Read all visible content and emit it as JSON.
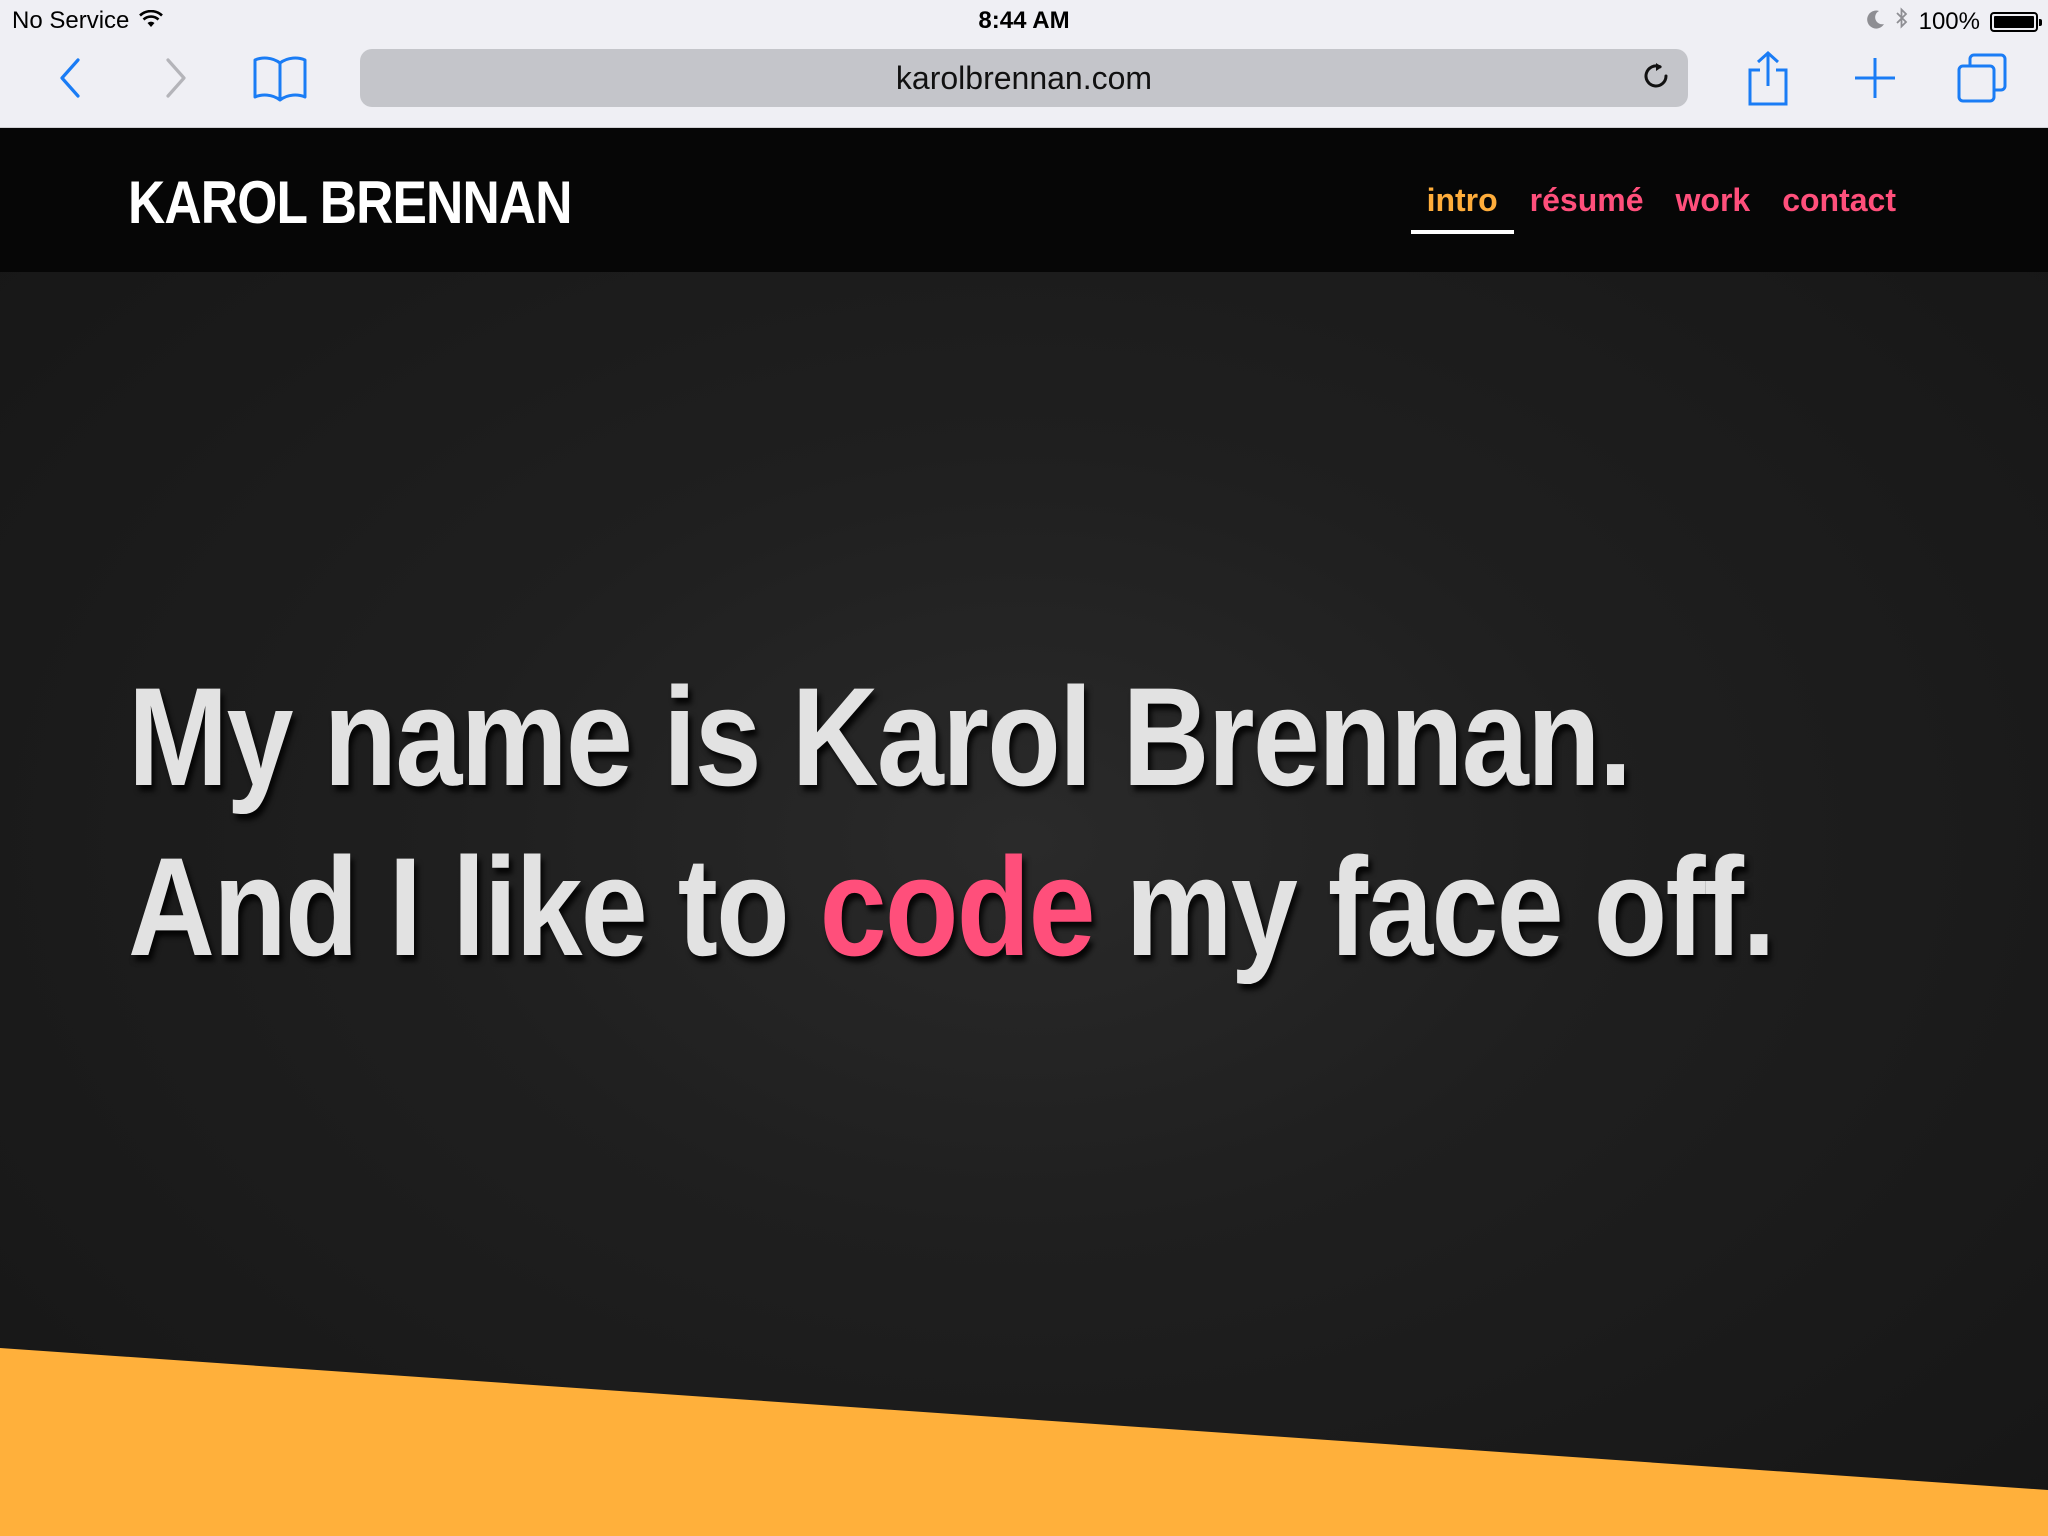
{
  "status_bar": {
    "carrier": "No Service",
    "time": "8:44 AM",
    "battery_percent": "100%",
    "battery_level": 1.0
  },
  "browser": {
    "url": "karolbrennan.com",
    "icons": {
      "back": "chevron-left-icon",
      "forward": "chevron-right-icon",
      "bookmarks": "book-icon",
      "reload": "reload-icon",
      "share": "share-icon",
      "new_tab": "plus-icon",
      "tabs": "tabs-icon"
    },
    "accent_color": "#1a7cf5"
  },
  "site": {
    "logo": "KAROL BRENNAN",
    "nav": [
      {
        "label": "intro",
        "active": true
      },
      {
        "label": "résumé",
        "active": false
      },
      {
        "label": "work",
        "active": false
      },
      {
        "label": "contact",
        "active": false
      }
    ],
    "hero": {
      "line1": "My name is Karol Brennan.",
      "line2_before": "And I like to ",
      "line2_accent": "code",
      "line2_after": " my face off."
    },
    "colors": {
      "header_bg": "#060606",
      "hero_text": "#e2e2e2",
      "pink": "#ff4f7b",
      "orange": "#ffb03b"
    }
  }
}
